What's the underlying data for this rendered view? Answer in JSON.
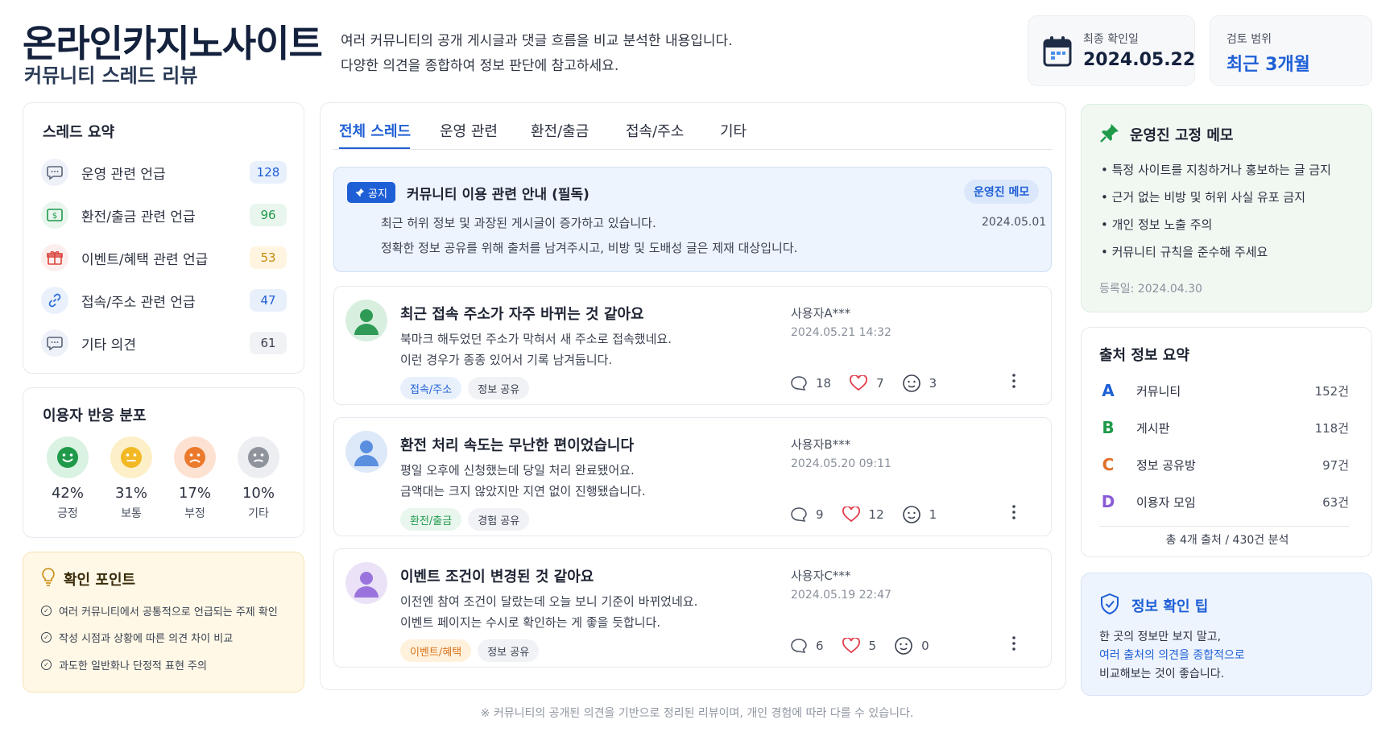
{
  "header": {
    "title": "온라인카지노사이트",
    "subtitle": "커뮤니티 스레드 리뷰",
    "desc_line1": "여러 커뮤니티의 공개 게시글과 댓글 흐름을 비교 분석한 내용입니다.",
    "desc_line2": "다양한 의견을 종합하여 정보 판단에 참고하세요.",
    "last_checked_label": "최종 확인일",
    "last_checked_value": "2024.05.22",
    "range_label": "검토 범위",
    "range_value": "최근 3개월"
  },
  "summary": {
    "title": "스레드 요약",
    "items": [
      {
        "label": "운영 관련 언급",
        "count": "128",
        "icon": "chat-icon"
      },
      {
        "label": "환전/출금 관련 언급",
        "count": "96",
        "icon": "money-icon"
      },
      {
        "label": "이벤트/혜택 관련 언급",
        "count": "53",
        "icon": "gift-icon"
      },
      {
        "label": "접속/주소 관련 언급",
        "count": "47",
        "icon": "link-icon"
      },
      {
        "label": "기타 의견",
        "count": "61",
        "icon": "chat-icon"
      }
    ]
  },
  "reactions": {
    "title": "이용자 반응 분포",
    "items": [
      {
        "pct": "42%",
        "label": "긍정",
        "icon": "smile-face-icon"
      },
      {
        "pct": "31%",
        "label": "보통",
        "icon": "neutral-face-icon"
      },
      {
        "pct": "17%",
        "label": "부정",
        "icon": "sad-face-icon"
      },
      {
        "pct": "10%",
        "label": "기타",
        "icon": "other-face-icon"
      }
    ]
  },
  "checkpoints": {
    "title": "확인 포인트",
    "items": [
      "여러 커뮤니티에서 공통적으로 언급되는 주제 확인",
      "작성 시점과 상황에 따른 의견 차이 비교",
      "과도한 일반화나 단정적 표현 주의"
    ]
  },
  "tabs": [
    "전체 스레드",
    "운영 관련",
    "환전/출금",
    "접속/주소",
    "기타"
  ],
  "notice": {
    "badge": "공지",
    "title": "커뮤니티 이용 관련 안내 (필독)",
    "tag": "운영진 메모",
    "line1": "최근 허위 정보 및 과장된 게시글이 증가하고 있습니다.",
    "line2": "정확한 정보 공유를 위해 출처를 남겨주시고, 비방 및 도배성 글은 제재 대상입니다.",
    "date": "2024.05.01"
  },
  "posts": [
    {
      "title": "최근 접속 주소가 자주 바뀌는 것 같아요",
      "line1": "북마크 해두었던 주소가 막혀서 새 주소로 접속했네요.",
      "line2": "이런 경우가 종종 있어서 기록 남겨둡니다.",
      "tags": [
        "접속/주소",
        "정보 공유"
      ],
      "author": "사용자A***",
      "date": "2024.05.21 14:32",
      "comments": "18",
      "likes": "7",
      "reactions": "3"
    },
    {
      "title": "환전 처리 속도는 무난한 편이었습니다",
      "line1": "평일 오후에 신청했는데 당일 처리 완료됐어요.",
      "line2": "금액대는 크지 않았지만 지연 없이 진행됐습니다.",
      "tags": [
        "환전/출금",
        "경험 공유"
      ],
      "author": "사용자B***",
      "date": "2024.05.20 09:11",
      "comments": "9",
      "likes": "12",
      "reactions": "1"
    },
    {
      "title": "이벤트 조건이 변경된 것 같아요",
      "line1": "이전엔 참여 조건이 달랐는데 오늘 보니 기준이 바뀌었네요.",
      "line2": "이벤트 페이지는 수시로 확인하는 게 좋을 듯합니다.",
      "tags": [
        "이벤트/혜택",
        "정보 공유"
      ],
      "author": "사용자C***",
      "date": "2024.05.19 22:47",
      "comments": "6",
      "likes": "5",
      "reactions": "0"
    }
  ],
  "memo": {
    "title": "운영진 고정 메모",
    "items": [
      "특정 사이트를 지칭하거나 홍보하는 글 금지",
      "근거 없는 비방 및 허위 사실 유포 금지",
      "개인 정보 노출 주의",
      "커뮤니티 규칙을 준수해 주세요"
    ],
    "registered": "등록일: 2024.04.30"
  },
  "sources": {
    "title": "출처 정보 요약",
    "items": [
      {
        "letter": "A",
        "name": "커뮤니티",
        "count": "152건",
        "color": "#1f5fd6"
      },
      {
        "letter": "B",
        "name": "게시판",
        "count": "118건",
        "color": "#1f9a4a"
      },
      {
        "letter": "C",
        "name": "정보 공유방",
        "count": "97건",
        "color": "#e0702a"
      },
      {
        "letter": "D",
        "name": "이용자 모임",
        "count": "63건",
        "color": "#8a5cd6"
      }
    ],
    "total": "총 4개 출처 / 430건 분석"
  },
  "tip": {
    "title": "정보 확인 팁",
    "line1": "한 곳의 정보만 보지 말고,",
    "line2": "여러 출처의 의견을 종합적으로",
    "line3": "비교해보는 것이 좋습니다."
  },
  "footer": "※ 커뮤니티의 공개된 의견을 기반으로 정리된 리뷰이며, 개인 경험에 따라 다를 수 있습니다.",
  "colors": {
    "accent": "#1f5fd6",
    "navy": "#14213d",
    "green": "#1f9a4a",
    "warn_bg": "#fff8e6"
  }
}
